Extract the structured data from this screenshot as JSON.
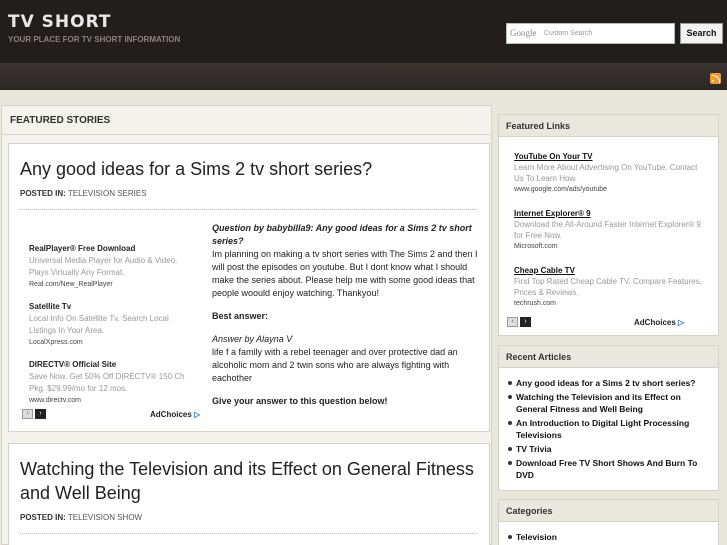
{
  "site": {
    "title": "TV SHORT",
    "tagline": "YOUR PLACE FOR TV SHORT INFORMATION"
  },
  "search": {
    "brand": "Google",
    "placeholder": "Custom Search",
    "button_label": "Search"
  },
  "main": {
    "section_title": "FEATURED STORIES",
    "posts": [
      {
        "title": "Any good ideas for a Sims 2 tv short series?",
        "posted_label": "POSTED IN:",
        "category": "TELEVISION SERIES",
        "question": "Question by babybilla9: Any good ideas for a Sims 2 tv short series?",
        "body": "Im planning on making a tv short series with The Sims 2 and then I will post the episodes on youtube. But I dont know what I should make the series about. Please help me with some good ideas that people woould enjoy watching. Thankyou!",
        "best_answer_label": "Best answer:",
        "answer_by": "Answer by Alayna V",
        "answer": "life f a family with a rebel teenager and over protective dad an alcoholic mom and 2 twin sons who are always fighting with eachother",
        "give_answer": "Give your answer to this question below!"
      },
      {
        "title": "Watching the Television and its Effect on General Fitness and Well Being",
        "posted_label": "POSTED IN:",
        "category": "TELEVISION SHOW"
      }
    ],
    "ads": [
      {
        "title": "RealPlayer® Free Download",
        "desc": "Universal Media Player for Audio & Video. Plays Virtually Any Format.",
        "url": "Real.com/New_RealPlayer"
      },
      {
        "title": "Satellite Tv",
        "desc": "Local Info On Satellite Tv. Search Local Listings In Your Area.",
        "url": "LocalXpress.com"
      },
      {
        "title": "DIRECTV® Official Site",
        "desc": "Save Now. Get 50% Off DIRECTV® 150 Ch Pkg. $29.99/mo for 12 mos.",
        "url": "www.directv.com"
      }
    ],
    "adchoices": "AdChoices"
  },
  "sidebar": {
    "featured_links": {
      "title": "Featured Links",
      "items": [
        {
          "title": "YouTube On Your TV",
          "desc": "Learn More About Advertising On YouTube. Contact Us To Learn How.",
          "url": "www.google.com/ads/youtube"
        },
        {
          "title": "Internet Explorer® 9",
          "desc": "Download the All-Around Faster Internet Explorer® 9 for Free Now.",
          "url": "Microsoft.com"
        },
        {
          "title": "Cheap Cable TV",
          "desc": "Find Top Rated Cheap Cable TV. Compare Features, Prices & Reviews.",
          "url": "techrush.com"
        }
      ],
      "adchoices": "AdChoices"
    },
    "recent_articles": {
      "title": "Recent Articles",
      "items": [
        "Any good ideas for a Sims 2 tv short series?",
        "Watching the Television and its Effect on General Fitness and Well Being",
        "An Introduction to Digital Light Processing Televisions",
        "TV Trivia",
        "Download Free TV Short Shows And Burn To DVD"
      ]
    },
    "categories": {
      "title": "Categories",
      "items": [
        "Television"
      ]
    }
  }
}
